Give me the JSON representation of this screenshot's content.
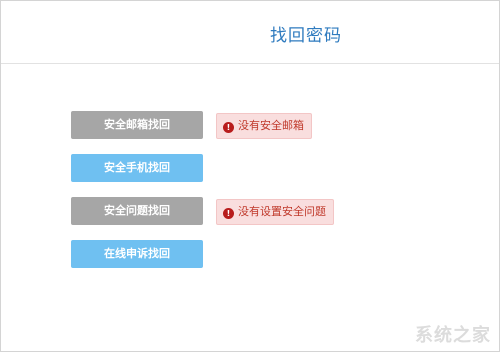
{
  "header": {
    "title": "找回密码"
  },
  "options": [
    {
      "label": "安全邮箱找回",
      "state": "disabled",
      "warning": "没有安全邮箱"
    },
    {
      "label": "安全手机找回",
      "state": "active"
    },
    {
      "label": "安全问题找回",
      "state": "disabled",
      "warning": "没有设置安全问题"
    },
    {
      "label": "在线申诉找回",
      "state": "active"
    }
  ],
  "warning_icon_glyph": "!",
  "watermark": "系统之家",
  "colors": {
    "title": "#2f7bbf",
    "disabled_button": "#a6a6a6",
    "active_button": "#6fc0f1",
    "warning_bg": "#f9dede",
    "warning_text": "#c0392b"
  }
}
